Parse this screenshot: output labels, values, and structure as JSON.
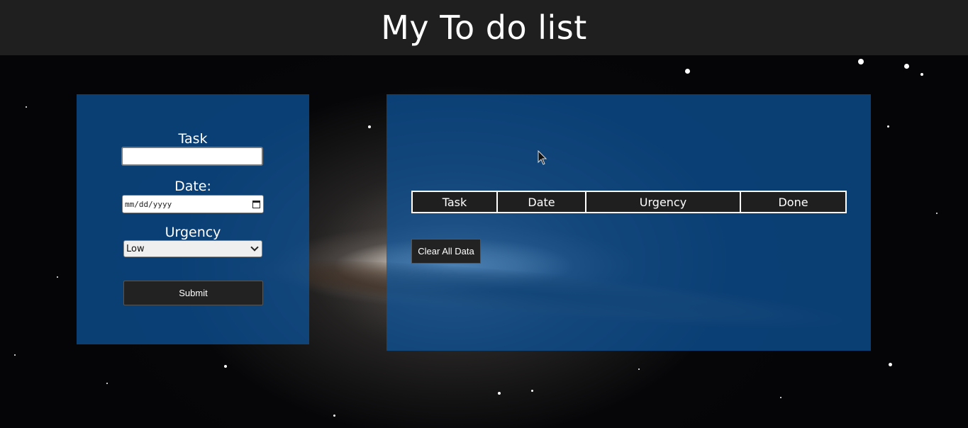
{
  "header": {
    "title": "My To do list"
  },
  "form": {
    "task_label": "Task",
    "task_value": "",
    "date_label": "Date:",
    "date_placeholder": "mm/dd/yyyy",
    "urgency_label": "Urgency",
    "urgency_selected": "Low",
    "submit_label": "Submit"
  },
  "list": {
    "columns": [
      "Task",
      "Date",
      "Urgency",
      "Done"
    ],
    "clear_label": "Clear All Data"
  },
  "colors": {
    "header_bg": "#1f1f1f",
    "panel_bg": "#0c56a0",
    "button_bg": "#222222"
  }
}
